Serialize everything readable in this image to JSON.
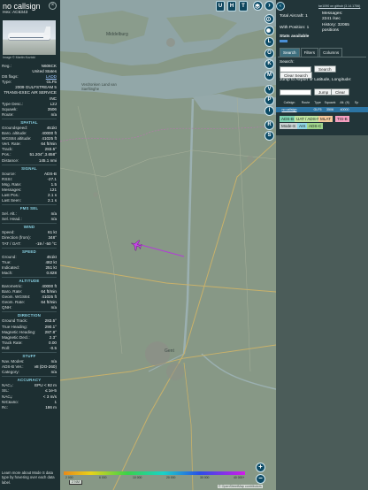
{
  "aircraft": {
    "callsign": "no callsign",
    "hex_label": "Hex:",
    "hex": "AC6343",
    "close_glyph": "×",
    "photo_credit": "Image © Martin Kozicki"
  },
  "info_rows": [
    {
      "k": "Reg.:",
      "v": "N606CK"
    },
    {
      "k": "",
      "v": "United States"
    },
    {
      "k": "DB flags:",
      "v": "LADD",
      "link": true
    },
    {
      "k": "Type:",
      "v": "GLF5"
    },
    {
      "k": "",
      "v": "2009 GULFSTREAM 5"
    },
    {
      "k": "",
      "v": "TRANS-EXEC AIR SERVICE"
    },
    {
      "k": "",
      "v": "INC"
    },
    {
      "k": "Type Desc.:",
      "v": "L2J"
    },
    {
      "k": "Squawk:",
      "v": "3506"
    },
    {
      "k": "Route:",
      "v": "n/a"
    }
  ],
  "sections": [
    {
      "title": "SPATIAL",
      "rows": [
        {
          "k": "Groundspeed:",
          "v": "451kt"
        },
        {
          "k": "Baro. altitude:",
          "v": "40000 ft"
        },
        {
          "k": "WGS84 altitude:",
          "v": "41025 ft"
        },
        {
          "k": "Vert. Rate:",
          "v": "64 ft/min"
        },
        {
          "k": "Track:",
          "v": "283.5°"
        },
        {
          "k": "Pos.:",
          "v": "51.204°,3.658°"
        },
        {
          "k": "Distance:",
          "v": "145.1 nmi"
        }
      ]
    },
    {
      "title": "SIGNAL",
      "rows": [
        {
          "k": "Source:",
          "v": "ADS-B"
        },
        {
          "k": "RSSI:",
          "v": "-27.1"
        },
        {
          "k": "Msg. Rate:",
          "v": "1.5"
        },
        {
          "k": "Messages:",
          "v": "121"
        },
        {
          "k": "Last Pos.:",
          "v": "2.1 s"
        },
        {
          "k": "Last Seen:",
          "v": "2.1 s"
        }
      ]
    },
    {
      "title": "FMS SEL",
      "rows": [
        {
          "k": "Sel. Alt.:",
          "v": "n/a"
        },
        {
          "k": "Sel. Head.:",
          "v": "n/a"
        }
      ]
    },
    {
      "title": "WIND",
      "rows": [
        {
          "k": "Speed:",
          "v": "61 kt"
        },
        {
          "k": "Direction (from):",
          "v": "348°"
        },
        {
          "k": "TAT / OAT:",
          "v": "-19 / -50 °C"
        }
      ]
    },
    {
      "title": "SPEED",
      "rows": [
        {
          "k": "Ground:",
          "v": "451kt"
        },
        {
          "k": "True:",
          "v": "482 kt"
        },
        {
          "k": "Indicated:",
          "v": "251 kt"
        },
        {
          "k": "Mach:",
          "v": "0.828"
        }
      ]
    },
    {
      "title": "ALTITUDE",
      "rows": [
        {
          "k": "Barometric:",
          "v": "40000 ft"
        },
        {
          "k": "Baro. Rate:",
          "v": "64 ft/min"
        },
        {
          "k": "Geom. WGS84:",
          "v": "41025 ft"
        },
        {
          "k": "Geom. Rate:",
          "v": "64 ft/min"
        },
        {
          "k": "QNH:",
          "v": "n/a"
        }
      ]
    },
    {
      "title": "DIRECTION",
      "rows": [
        {
          "k": "Ground Track:",
          "v": "283.5°"
        },
        {
          "k": "True Heading:",
          "v": "290.1°"
        },
        {
          "k": "Magnetic Heading:",
          "v": "287.8°"
        },
        {
          "k": "Magnetic Decl.:",
          "v": "2.3°"
        },
        {
          "k": "Track Rate:",
          "v": "0.00"
        },
        {
          "k": "Roll:",
          "v": "-0.5"
        }
      ]
    },
    {
      "title": "STUFF",
      "rows": [
        {
          "k": "Nav. Modes:",
          "v": "n/a"
        },
        {
          "k": "ADS-B Ver.:",
          "v": "v8 (DO-260)"
        },
        {
          "k": "Category:",
          "v": "n/a"
        }
      ]
    },
    {
      "title": "ACCURACY",
      "rows": [
        {
          "k": "NACₚ:",
          "v": "EPU < 92 m"
        },
        {
          "k": "SIL:",
          "v": "≤ 1e-5"
        },
        {
          "k": "NACᵥ:",
          "v": "< 3 m/s"
        },
        {
          "k": "NICʙᴀʀᴏ:",
          "v": "1"
        },
        {
          "k": "Rc:",
          "v": "186 m"
        }
      ]
    }
  ],
  "footer_note": "Learn more about Mode S data type by hovering over each data label.",
  "map": {
    "top_buttons": [
      "U",
      "H",
      "T"
    ],
    "side_buttons": [
      "L",
      "O",
      "K",
      "M",
      "V",
      "P",
      "I",
      "R",
      "S"
    ],
    "labels": {
      "north_city": "Middelburg",
      "nature": "Verdronken Land van Saeftinghe",
      "south_city": "Gent"
    },
    "scale_label": "2 NM",
    "attribution": "© OpenStreetMap contributors",
    "altitude_ticks": [
      "2 000",
      "6 000",
      "10 000",
      "20 000",
      "30 000",
      "40 000+"
    ],
    "zoom_in": "+",
    "zoom_out": "−",
    "arrow_glyph": "›",
    "colors": {
      "track": "#b23dd6",
      "plane": "#c546e6",
      "water": "#8fa5a6",
      "land": "#889a89"
    }
  },
  "right": {
    "github_text": "tar1090 on github (3.14.1756)",
    "total_label": "Total Aircraft:",
    "total_value": "1",
    "messages_label": "Messages:",
    "messages_value": "2241 /sec",
    "with_pos_label": "With Position:",
    "with_pos_value": "1",
    "history_label": "History:",
    "history_value": "32065 positions",
    "stats_label": "Stats available",
    "tabs": [
      "Search",
      "Filters",
      "Columns"
    ],
    "search_label": "Search:",
    "search_button": "Search",
    "clear_button": "Clear Search",
    "jump_label": "Jump to Airport or Latitude, Longitude:",
    "jump_button": "Jump",
    "jump_clear_button": "Clear",
    "table_headers": [
      "Callsign",
      "Route",
      "Type",
      "Squawk",
      "Alt. (ft)",
      "Sp"
    ],
    "table_row": [
      "no callsign",
      "",
      "GLF5",
      "3506",
      "40000",
      ""
    ],
    "legend": [
      {
        "label": "ADS-B",
        "color": "#7fd4b3"
      },
      {
        "label": "UAT / ADS-R",
        "color": "#bfe3a0"
      },
      {
        "label": "MLAT",
        "color": "#f2c79a"
      },
      {
        "label": "TIS-B",
        "color": "#f49fc0"
      },
      {
        "label": "Mode-S",
        "color": "#c9d2d2"
      },
      {
        "label": "AIS",
        "color": "#8fd6e4"
      },
      {
        "label": "ADS-C",
        "color": "#9fd48b"
      }
    ]
  }
}
